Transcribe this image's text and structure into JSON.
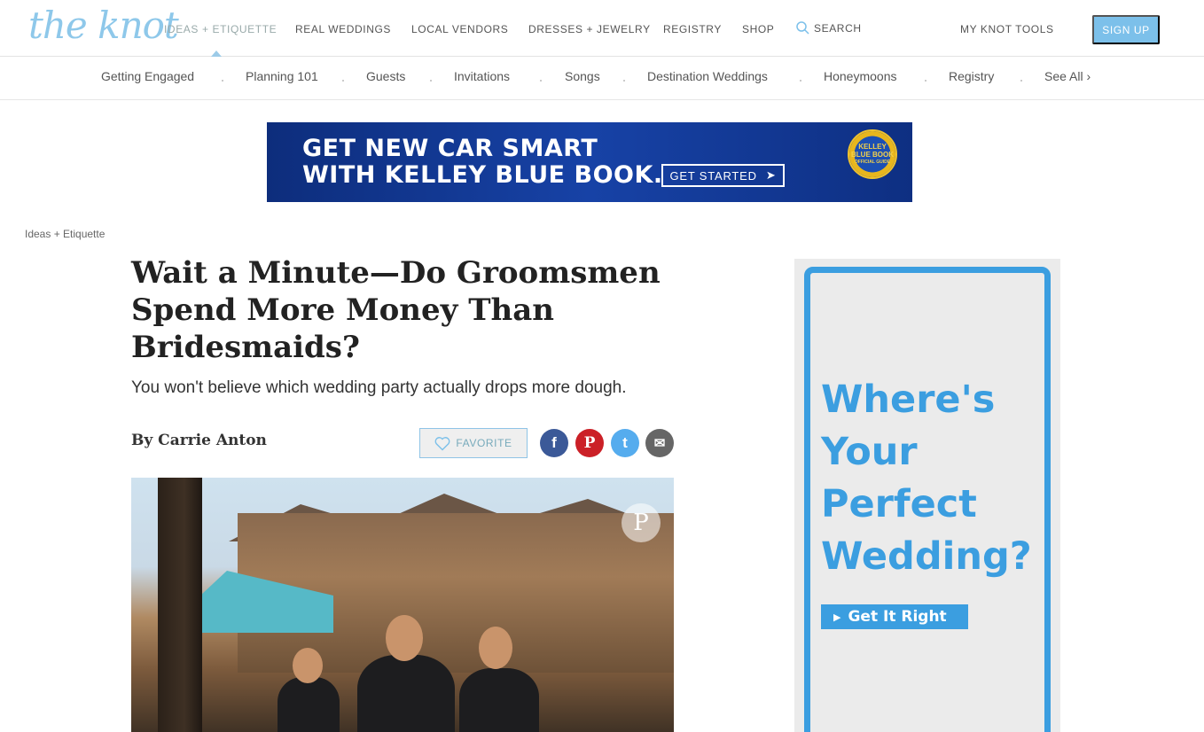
{
  "brand": {
    "logo_text": "the knot"
  },
  "topnav": {
    "items": [
      {
        "label": "IDEAS + ETIQUETTE"
      },
      {
        "label": "REAL WEDDINGS"
      },
      {
        "label": "LOCAL VENDORS"
      },
      {
        "label": "DRESSES + JEWELRY"
      },
      {
        "label": "REGISTRY"
      },
      {
        "label": "SHOP"
      }
    ],
    "search_label": "SEARCH",
    "tools_label": "MY KNOT TOOLS",
    "signup_label": "SIGN UP"
  },
  "subnav": {
    "items": [
      {
        "label": "Getting Engaged"
      },
      {
        "label": "Planning 101"
      },
      {
        "label": "Guests"
      },
      {
        "label": "Invitations"
      },
      {
        "label": "Songs"
      },
      {
        "label": "Destination Weddings"
      },
      {
        "label": "Honeymoons"
      },
      {
        "label": "Registry"
      },
      {
        "label": "See All ›"
      }
    ]
  },
  "ad_banner": {
    "line1": "GET NEW CAR SMART",
    "line2": "WITH KELLEY BLUE BOOK.",
    "button": "GET STARTED",
    "badge_top": "KELLEY",
    "badge_mid": "BLUE BOOK",
    "badge_bottom": "OFFICIAL GUIDE"
  },
  "article": {
    "breadcrumb": "Ideas + Etiquette",
    "title": "Wait a Minute—Do Groomsmen Spend More Money Than Bridesmaids?",
    "subtitle": "You won't believe which wedding party actually drops more dough.",
    "byline": "By Carrie Anton",
    "favorite_label": "FAVORITE"
  },
  "share": {
    "facebook": "f",
    "pinterest": "P",
    "twitter": "t",
    "email": "✉"
  },
  "side_ad": {
    "line1": "Where's",
    "line2": "Your",
    "line3": "Perfect",
    "line4": "Wedding?",
    "button": "Get It Right"
  },
  "colors": {
    "accent": "#7cc0ea",
    "ad_blue": "#3b9ee0",
    "facebook": "#3b5998",
    "pinterest": "#cb2027",
    "twitter": "#55acee",
    "email": "#666666"
  }
}
